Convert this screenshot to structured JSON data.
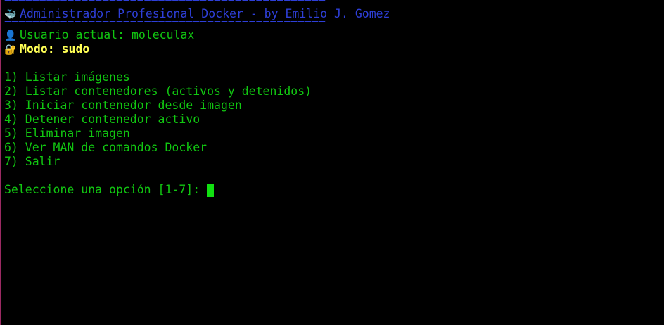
{
  "header": {
    "separator": "==============================================",
    "icon": "whale-icon",
    "title": "Administrador Profesional Docker - by Emilio J. Gomez"
  },
  "status": {
    "user_icon": "user-icon",
    "user_line": "Usuario actual: moleculax",
    "mode_icon": "lock-icon",
    "mode_line": "Modo: sudo"
  },
  "menu": {
    "items": [
      "1) Listar imágenes",
      "2) Listar contenedores (activos y detenidos)",
      "3) Iniciar contenedor desde imagen",
      "4) Detener contenedor activo",
      "5) Eliminar imagen",
      "6) Ver MAN de comandos Docker",
      "7) Salir"
    ]
  },
  "prompt": {
    "text": "Seleccione una opción [1-7]: ",
    "input_value": ""
  },
  "colors": {
    "background": "#000000",
    "text_green": "#11c711",
    "header_blue": "#2e3fd8",
    "mode_yellow": "#ffff55",
    "cursor": "#11e011"
  }
}
